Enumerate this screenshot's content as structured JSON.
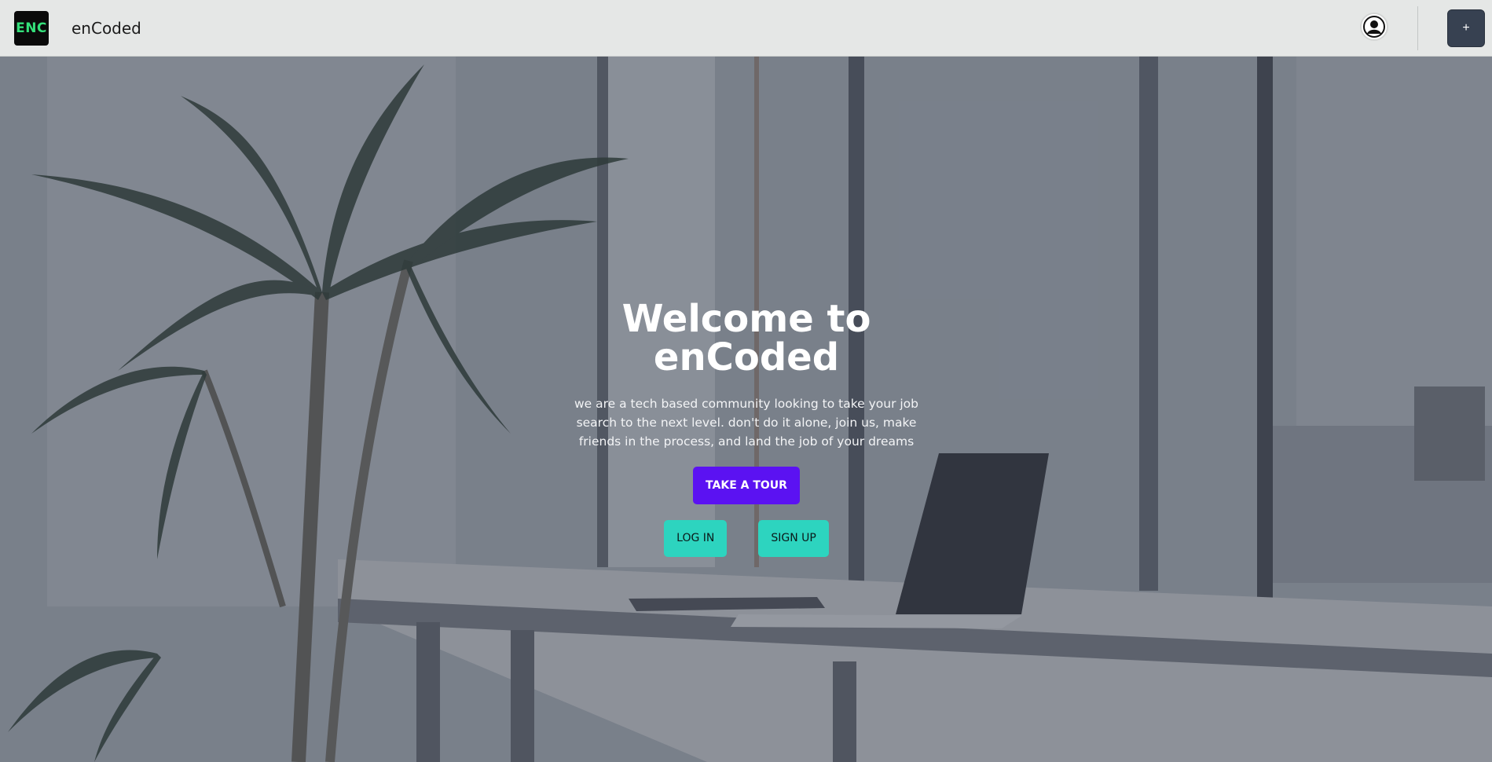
{
  "header": {
    "logo_text": "ENC",
    "brand": "enCoded",
    "add_label": "+",
    "avatar_icon": "user-avatar-icon"
  },
  "hero": {
    "title": "Welcome to enCoded",
    "description": "we are a tech based community looking to take your job search to the next level. don't do it alone, join us, make friends in the process, and land the job of your dreams",
    "tour_label": "TAKE A TOUR",
    "login_label": "LOG IN",
    "signup_label": "SIGN UP"
  },
  "colors": {
    "navbar": "#e5e7e6",
    "logo_bg": "#0a0a0a",
    "logo_text": "#34e07a",
    "tour_button": "#5b12f2",
    "auth_button": "#2dd4bf",
    "add_button": "#374151"
  }
}
